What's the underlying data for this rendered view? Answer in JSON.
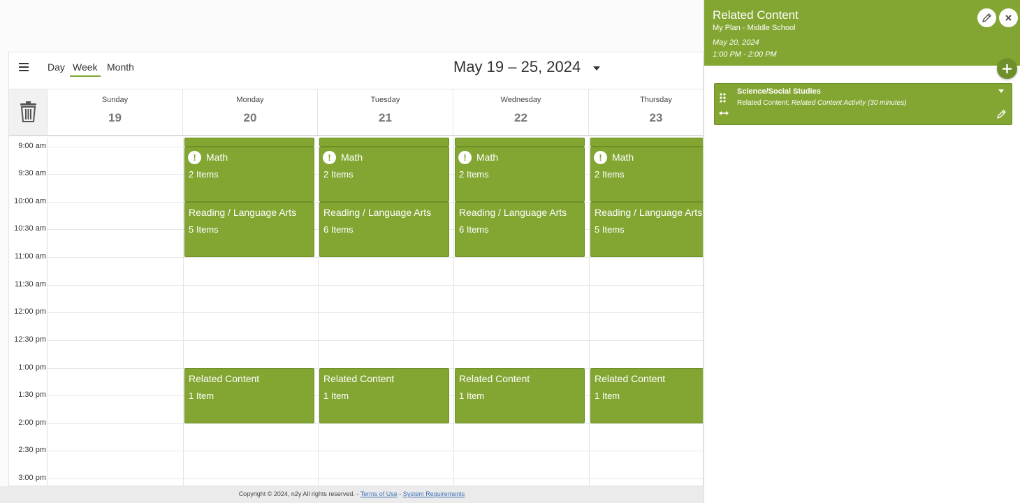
{
  "toolbar": {
    "menu_icon": "hamburger-icon",
    "views": {
      "day": "Day",
      "week": "Week",
      "month": "Month"
    },
    "active_view": "Week",
    "date_range": "May 19 – 25, 2024"
  },
  "days": [
    {
      "name": "Sunday",
      "date": "19"
    },
    {
      "name": "Monday",
      "date": "20"
    },
    {
      "name": "Tuesday",
      "date": "21"
    },
    {
      "name": "Wednesday",
      "date": "22"
    },
    {
      "name": "Thursday",
      "date": "23"
    }
  ],
  "times": [
    "9:00 am",
    "9:30 am",
    "10:00 am",
    "10:30 am",
    "11:00 am",
    "11:30 am",
    "12:00 pm",
    "12:30 pm",
    "1:00 pm",
    "1:30 pm",
    "2:00 pm",
    "2:30 pm",
    "3:00 pm"
  ],
  "events": {
    "monday": [
      {
        "title": "Math",
        "items": "2 Items",
        "alert": "!"
      },
      {
        "title": "Reading / Language Arts",
        "items": "5 Items"
      },
      {
        "title": "Related Content",
        "items": "1 Item"
      }
    ],
    "tuesday": [
      {
        "title": "Math",
        "items": "2 Items",
        "alert": "!"
      },
      {
        "title": "Reading / Language Arts",
        "items": "6 Items"
      },
      {
        "title": "Related Content",
        "items": "1 Item"
      }
    ],
    "wednesday": [
      {
        "title": "Math",
        "items": "2 Items",
        "alert": "!"
      },
      {
        "title": "Reading / Language Arts",
        "items": "6 Items"
      },
      {
        "title": "Related Content",
        "items": "1 Item"
      }
    ],
    "thursday": [
      {
        "title": "Math",
        "items": "2 Items",
        "alert": "!"
      },
      {
        "title": "Reading / Language Arts",
        "items": "5 Items"
      },
      {
        "title": "Related Content",
        "items": "1 Item"
      }
    ]
  },
  "footer": {
    "copyright": "Copyright © 2024, n2y All rights reserved. - ",
    "terms": "Terms of Use",
    "sep": " - ",
    "requirements": "System Requirements"
  },
  "panel": {
    "title": "Related Content",
    "subtitle": "My Plan - Middle School",
    "date": "May 20, 2024",
    "time": "1:00 PM - 2:00 PM",
    "card": {
      "title": "Science/Social Studies",
      "desc_label": "Related Content: ",
      "desc_value": "Related Content Activity (30 minutes)"
    }
  },
  "colors": {
    "event_green": "#83a633",
    "accent": "#7fa834"
  }
}
